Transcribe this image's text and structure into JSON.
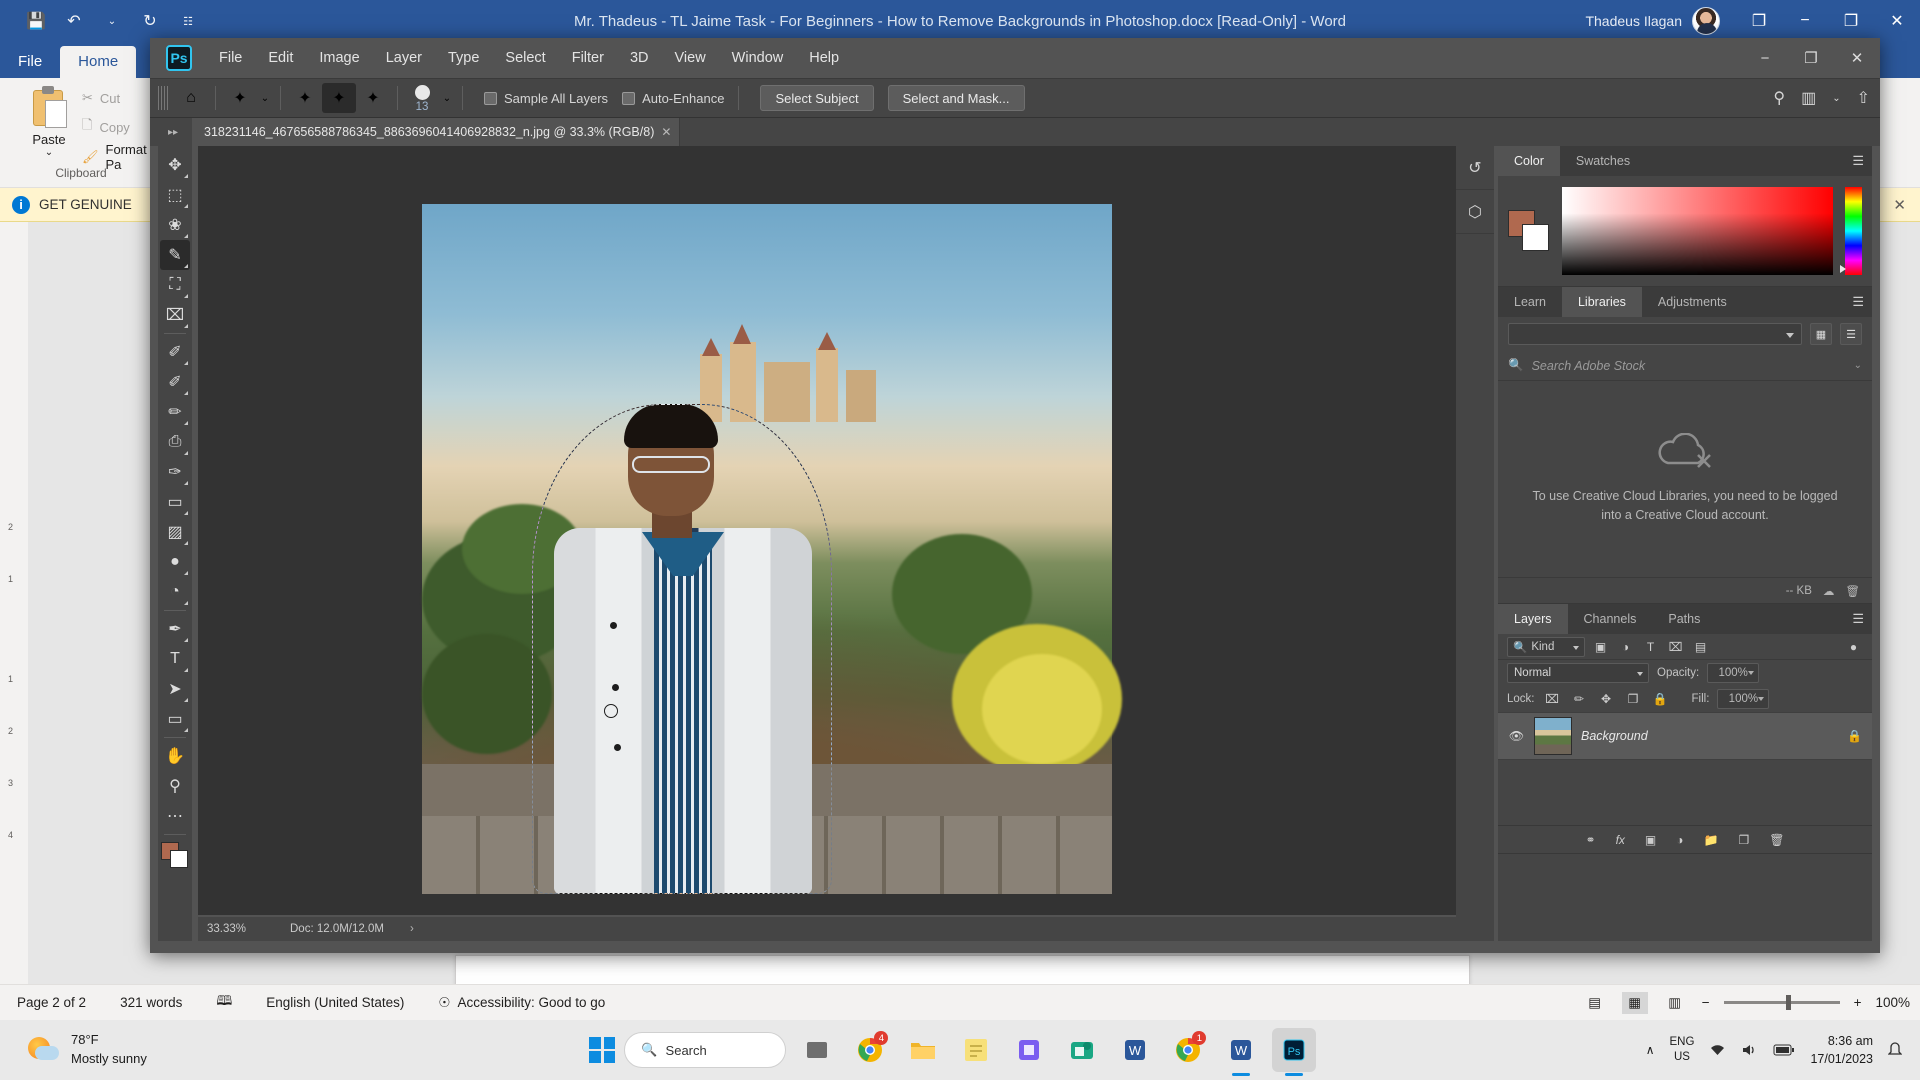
{
  "word": {
    "title": "Mr. Thadeus -  TL Jaime Task - For Beginners - How to Remove Backgrounds in Photoshop.docx [Read-Only]  -  Word",
    "user_name": "Thadeus Ilagan",
    "quick_access": [
      {
        "name": "save-icon",
        "glyph": "💾"
      },
      {
        "name": "undo-icon",
        "glyph": "↶"
      },
      {
        "name": "undo-dropdown-icon",
        "glyph": "⌄"
      },
      {
        "name": "redo-icon",
        "glyph": "↻"
      },
      {
        "name": "customize-qat-icon",
        "glyph": "☷"
      }
    ],
    "ribbon_tabs": [
      {
        "label": "File",
        "active": false
      },
      {
        "label": "Home",
        "active": true
      }
    ],
    "clipboard": {
      "paste_label": "Paste",
      "cut_label": "Cut",
      "copy_label": "Copy",
      "format_painter_label": "Format Pa",
      "group_label": "Clipboard"
    },
    "notice": {
      "text": "GET GENUINE",
      "close_label": "✕"
    },
    "window_controls": [
      {
        "name": "ribbon-display-options-icon",
        "glyph": "❐"
      },
      {
        "name": "minimize-icon",
        "glyph": "−"
      },
      {
        "name": "restore-icon",
        "glyph": "❐"
      },
      {
        "name": "close-icon",
        "glyph": "✕"
      }
    ],
    "status": {
      "page": "Page 2 of 2",
      "words": "321 words",
      "proofing_icon": "proofing-errors-icon",
      "language": "English (United States)",
      "accessibility": "Accessibility: Good to go",
      "zoom_percent": "100%",
      "zoom_out": "−",
      "zoom_in": "+",
      "views": [
        {
          "name": "read-mode-view-icon",
          "glyph": "▤"
        },
        {
          "name": "print-layout-view-icon",
          "glyph": "▦"
        },
        {
          "name": "web-layout-view-icon",
          "glyph": "▥"
        }
      ]
    },
    "ruler_marks": [
      "2",
      "1",
      "",
      "1",
      "2",
      "3",
      "4"
    ]
  },
  "photoshop": {
    "app_logo": "Ps",
    "menus": [
      "File",
      "Edit",
      "Image",
      "Layer",
      "Type",
      "Select",
      "Filter",
      "3D",
      "View",
      "Window",
      "Help"
    ],
    "window_controls": [
      {
        "name": "minimize-icon",
        "glyph": "−"
      },
      {
        "name": "restore-icon",
        "glyph": "❐"
      },
      {
        "name": "close-icon",
        "glyph": "✕"
      }
    ],
    "options_bar": {
      "home_icon": "home-icon",
      "tool_preset_icon": "quick-selection-tool-preset-icon",
      "mode_buttons": [
        {
          "name": "new-selection-icon",
          "active": false
        },
        {
          "name": "add-to-selection-icon",
          "active": true
        },
        {
          "name": "subtract-from-selection-icon",
          "active": false
        }
      ],
      "brush_size": "13",
      "sample_all_layers": {
        "label": "Sample All Layers",
        "checked": false
      },
      "auto_enhance": {
        "label": "Auto-Enhance",
        "checked": false
      },
      "select_subject": "Select Subject",
      "select_and_mask": "Select and Mask...",
      "right_icons": [
        {
          "name": "search-icon",
          "glyph": "⚲"
        },
        {
          "name": "arrange-documents-icon",
          "glyph": "▥"
        },
        {
          "name": "arrange-dropdown-icon",
          "glyph": "⌄"
        },
        {
          "name": "share-icon",
          "glyph": "⇧"
        }
      ]
    },
    "document_tab": {
      "title": "318231146_467656588786345_8863696041406928832_n.jpg @ 33.3% (RGB/8)",
      "close": "✕"
    },
    "collapse_icon": "collapse-panel-icon",
    "toolbox": [
      {
        "name": "move-tool",
        "glyph": "✥",
        "active": false
      },
      {
        "name": "rectangular-marquee-tool",
        "glyph": "⬚",
        "active": false
      },
      {
        "name": "lasso-tool",
        "glyph": "❀",
        "active": false
      },
      {
        "name": "quick-selection-tool",
        "glyph": "✎",
        "active": true
      },
      {
        "name": "crop-tool",
        "glyph": "⛶",
        "active": false
      },
      {
        "name": "frame-tool",
        "glyph": "⌧",
        "active": false
      },
      {
        "name": "eyedropper-tool",
        "glyph": "✐",
        "active": false
      },
      {
        "name": "spot-healing-brush-tool",
        "glyph": "✐",
        "active": false
      },
      {
        "name": "brush-tool",
        "glyph": "✏",
        "active": false
      },
      {
        "name": "clone-stamp-tool",
        "glyph": "⎙",
        "active": false
      },
      {
        "name": "history-brush-tool",
        "glyph": "✑",
        "active": false
      },
      {
        "name": "eraser-tool",
        "glyph": "▭",
        "active": false
      },
      {
        "name": "gradient-tool",
        "glyph": "▨",
        "active": false
      },
      {
        "name": "blur-tool",
        "glyph": "●",
        "active": false
      },
      {
        "name": "dodge-tool",
        "glyph": "◔",
        "active": false
      },
      {
        "name": "pen-tool",
        "glyph": "✒",
        "active": false
      },
      {
        "name": "horizontal-type-tool",
        "glyph": "T",
        "active": false
      },
      {
        "name": "path-selection-tool",
        "glyph": "➤",
        "active": false
      },
      {
        "name": "rectangle-tool",
        "glyph": "▭",
        "active": false
      },
      {
        "name": "hand-tool",
        "glyph": "✋",
        "active": false
      },
      {
        "name": "zoom-tool",
        "glyph": "⚲",
        "active": false
      },
      {
        "name": "edit-toolbar-tool",
        "glyph": "⋯",
        "active": false
      }
    ],
    "color_panel": {
      "tabs": [
        {
          "label": "Color",
          "active": true
        },
        {
          "label": "Swatches",
          "active": false
        }
      ],
      "foreground_color": "#b0694f",
      "background_color": "#ffffff"
    },
    "libraries_panel": {
      "tabs": [
        {
          "label": "Learn",
          "active": false
        },
        {
          "label": "Libraries",
          "active": true
        },
        {
          "label": "Adjustments",
          "active": false
        }
      ],
      "search_placeholder": "Search Adobe Stock",
      "empty_message": "To use Creative Cloud Libraries, you need to be logged into a Creative Cloud account.",
      "footer_size": "-- KB",
      "grid_view_icon": "grid-view-icon",
      "list_view_icon": "list-view-icon",
      "sync-icon": "cloud-sync-icon",
      "delete_icon": "delete-icon"
    },
    "layers_panel": {
      "tabs": [
        {
          "label": "Layers",
          "active": true
        },
        {
          "label": "Channels",
          "active": false
        },
        {
          "label": "Paths",
          "active": false
        }
      ],
      "filter_kind": "Kind",
      "filter_icons": [
        {
          "name": "filter-pixel-layers-icon",
          "glyph": "▣"
        },
        {
          "name": "filter-adjustment-layers-icon",
          "glyph": "◑"
        },
        {
          "name": "filter-type-layers-icon",
          "glyph": "T"
        },
        {
          "name": "filter-shape-layers-icon",
          "glyph": "⌧"
        },
        {
          "name": "filter-smart-objects-icon",
          "glyph": "▤"
        },
        {
          "name": "filter-toggle-icon",
          "glyph": "●"
        }
      ],
      "blend_mode": "Normal",
      "opacity_label": "Opacity:",
      "opacity_value": "100%",
      "lock_label": "Lock:",
      "lock_icons": [
        {
          "name": "lock-transparent-pixels-icon",
          "glyph": "⌧"
        },
        {
          "name": "lock-image-pixels-icon",
          "glyph": "✏"
        },
        {
          "name": "lock-position-icon",
          "glyph": "✥"
        },
        {
          "name": "lock-artboard-nesting-icon",
          "glyph": "❐"
        },
        {
          "name": "lock-all-icon",
          "glyph": "🔒"
        }
      ],
      "fill_label": "Fill:",
      "fill_value": "100%",
      "layers": [
        {
          "name": "Background",
          "visible": true,
          "locked": true
        }
      ],
      "footer_icons": [
        {
          "name": "link-layers-icon",
          "glyph": "⚭"
        },
        {
          "name": "layer-style-icon",
          "glyph": "fx"
        },
        {
          "name": "layer-mask-icon",
          "glyph": "▣"
        },
        {
          "name": "adjustment-layer-icon",
          "glyph": "◑"
        },
        {
          "name": "new-group-icon",
          "glyph": "📁"
        },
        {
          "name": "new-layer-icon",
          "glyph": "❐"
        },
        {
          "name": "delete-layer-icon",
          "glyph": "🗑"
        }
      ]
    },
    "rail_icons": [
      {
        "name": "history-panel-icon",
        "glyph": "↺"
      },
      {
        "name": "3d-panel-icon",
        "glyph": "⬡"
      }
    ],
    "status_bar": {
      "zoom": "33.33%",
      "doc_info": "Doc: 12.0M/12.0M",
      "arrow": "›"
    }
  },
  "taskbar": {
    "weather": {
      "temperature": "78°F",
      "condition": "Mostly sunny"
    },
    "start_label": "start-button",
    "search_placeholder": "Search",
    "apps": [
      {
        "name": "task-view-button",
        "badge": ""
      },
      {
        "name": "google-chrome-app",
        "badge": "4"
      },
      {
        "name": "file-explorer-app",
        "badge": ""
      },
      {
        "name": "sticky-notes-app",
        "badge": ""
      },
      {
        "name": "snipping-tool-app",
        "badge": ""
      },
      {
        "name": "microsoft-teams-app",
        "badge": ""
      },
      {
        "name": "word-webapp",
        "badge": ""
      },
      {
        "name": "google-chrome-second-app",
        "badge": "1"
      },
      {
        "name": "microsoft-word-app",
        "badge": ""
      },
      {
        "name": "adobe-photoshop-app",
        "badge": ""
      }
    ],
    "tray": {
      "overflow": "∧",
      "language_line1": "ENG",
      "language_line2": "US",
      "wifi_icon": "wifi-icon",
      "volume_icon": "volume-icon",
      "battery_icon": "battery-icon",
      "time": "8:36 am",
      "date": "17/01/2023"
    }
  }
}
